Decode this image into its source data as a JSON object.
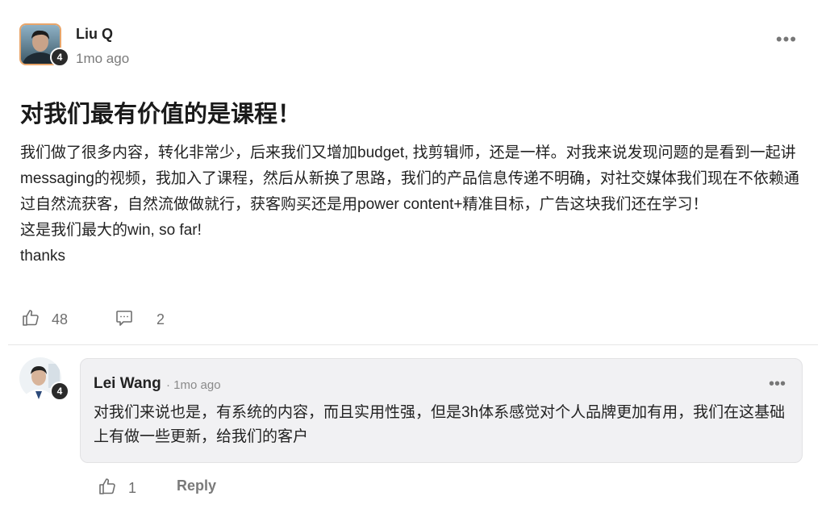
{
  "post": {
    "author": {
      "name": "Liu Q",
      "level": "4",
      "time": "1mo ago"
    },
    "more_icon": "more-horizontal-icon",
    "title": "对我们最有价值的是课程！",
    "body": [
      "我们做了很多内容，转化非常少，后来我们又增加budget, 找剪辑师，还是一样。对我来说发现问题的是看到一起讲messaging的视频，我加入了课程，然后从新换了思路，我们的产品信息传递不明确，对社交媒体我们现在不依赖通过自然流获客，自然流做做就行，获客购买还是用power content+精准目标，广告这块我们还在学习！",
      "这是我们最大的win, so far!",
      "thanks"
    ],
    "likes": "48",
    "comments": "2",
    "like_icon": "thumbs-up-icon",
    "comment_icon": "comment-icon"
  },
  "comment": {
    "author": "Lei Wang",
    "level": "4",
    "time": "· 1mo ago",
    "text": "对我们来说也是，有系统的内容，而且实用性强，但是3h体系感觉对个人品牌更加有用，我们在这基础上有做一些更新，给我们的客户",
    "likes": "1",
    "reply_label": "Reply"
  },
  "colors": {
    "avatar_border": "#e8a56a",
    "bubble_bg": "#f1f1f3",
    "badge_bg": "#2a2a2a"
  }
}
